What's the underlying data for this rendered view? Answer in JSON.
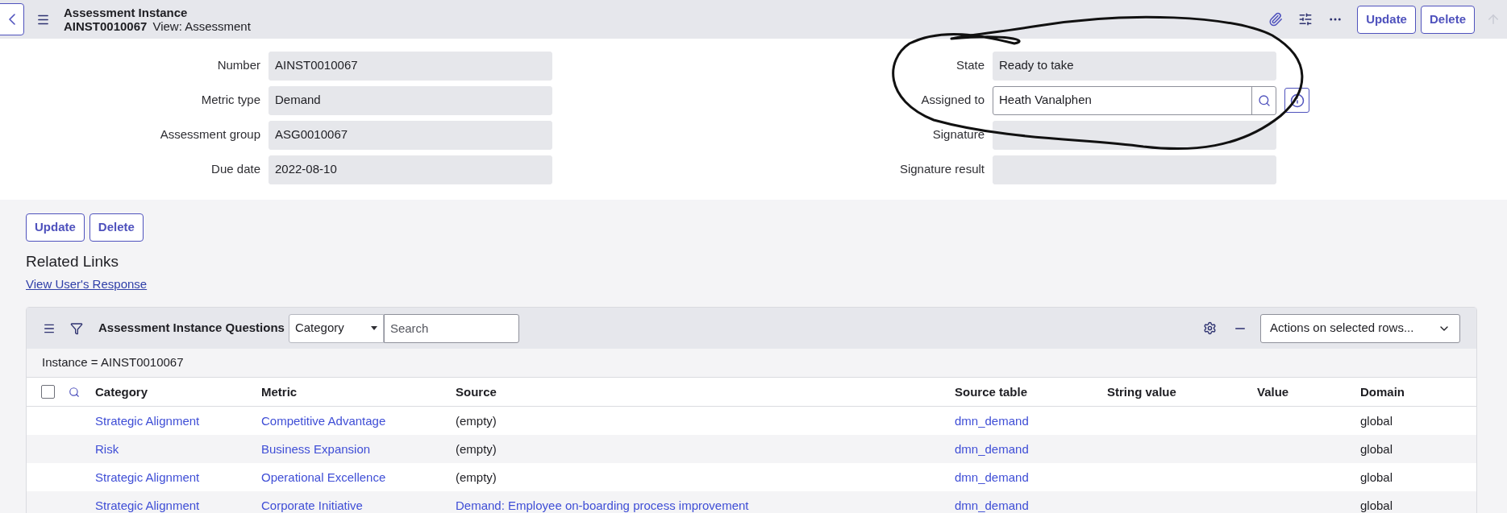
{
  "header": {
    "title": "Assessment Instance",
    "number": "AINST0010067",
    "view": "View: Assessment",
    "buttons": [
      "Update",
      "Delete"
    ],
    "up_disabled": true
  },
  "form": {
    "left": [
      {
        "label": "Number",
        "value": "AINST0010067",
        "readonly": true
      },
      {
        "label": "Metric type",
        "value": "Demand",
        "readonly": true
      },
      {
        "label": "Assessment group",
        "value": "ASG0010067",
        "readonly": true
      },
      {
        "label": "Due date",
        "value": "2022-08-10",
        "readonly": true
      }
    ],
    "right": [
      {
        "label": "State",
        "value": "Ready to take",
        "readonly": true,
        "kind": "text"
      },
      {
        "label": "Assigned to",
        "value": "Heath Vanalphen",
        "readonly": false,
        "kind": "reference"
      },
      {
        "label": "Signature",
        "readonly": true,
        "kind": "text"
      },
      {
        "label": "Signature result",
        "readonly": true,
        "kind": "text"
      }
    ]
  },
  "form_buttons": [
    "Update",
    "Delete"
  ],
  "related_links": {
    "title": "Related Links",
    "links": [
      "View User's Response"
    ]
  },
  "list": {
    "title": "Assessment Instance Questions",
    "filter_field": "Category",
    "search_placeholder": "Search",
    "actions": "Actions on selected rows...",
    "breadcrumb": "Instance = AINST0010067",
    "select_all_checked": false,
    "columns": [
      "Category",
      "Metric",
      "Source",
      "Source table",
      "String value",
      "Value",
      "Domain"
    ],
    "rows": [
      {
        "category": "Strategic Alignment",
        "metric": "Competitive Advantage",
        "source": "(empty)",
        "source_is_link": false,
        "source_table": "dmn_demand",
        "domain": "global"
      },
      {
        "category": "Risk",
        "metric": "Business Expansion",
        "source": "(empty)",
        "source_is_link": false,
        "source_table": "dmn_demand",
        "domain": "global"
      },
      {
        "category": "Strategic Alignment",
        "metric": "Operational Excellence",
        "source": "(empty)",
        "source_is_link": false,
        "source_table": "dmn_demand",
        "domain": "global"
      },
      {
        "category": "Strategic Alignment",
        "metric": "Corporate Initiative",
        "source": "Demand: Employee on-boarding process improvement",
        "source_is_link": true,
        "source_table": "dmn_demand",
        "domain": "global"
      }
    ]
  }
}
